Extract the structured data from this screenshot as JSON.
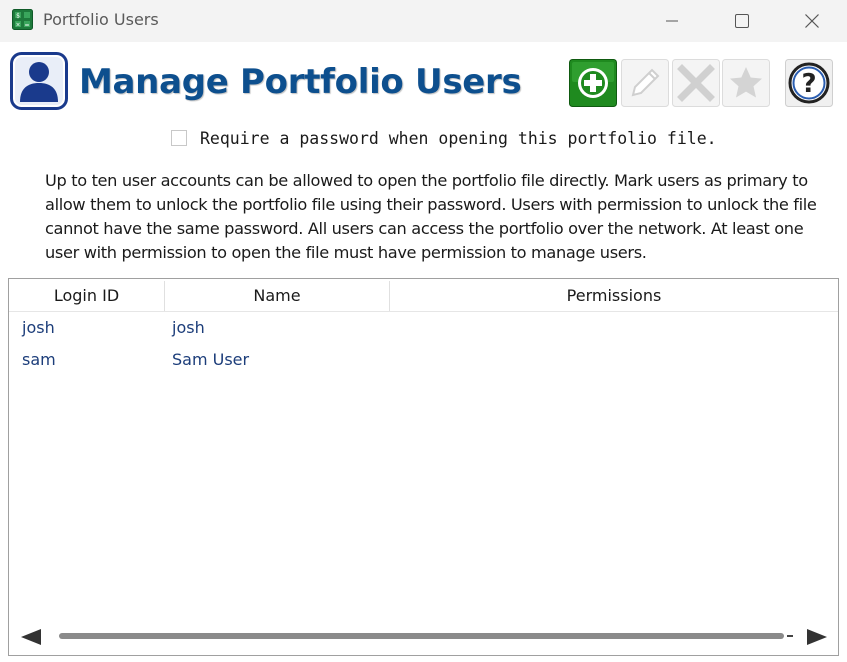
{
  "window": {
    "title": "Portfolio Users",
    "icon": "spreadsheet-icon"
  },
  "header": {
    "title": "Manage Portfolio Users",
    "icon": "user-icon"
  },
  "toolbar": {
    "buttons": [
      {
        "name": "add-user-button",
        "icon": "plus-icon",
        "enabled": true
      },
      {
        "name": "edit-user-button",
        "icon": "pencil-icon",
        "enabled": false
      },
      {
        "name": "delete-user-button",
        "icon": "x-icon",
        "enabled": false
      },
      {
        "name": "primary-user-button",
        "icon": "star-icon",
        "enabled": false
      },
      {
        "name": "help-button",
        "icon": "question-icon",
        "enabled": true
      }
    ]
  },
  "password_option": {
    "label": "Require a password when opening this portfolio file.",
    "checked": false
  },
  "description": "Up to ten user accounts can be allowed to open the portfolio file directly. Mark users as primary to allow them to unlock the portfolio file using their password. Users with permission to unlock the file cannot have the same password. All users can access the portfolio over the network. At least one user with permission to open the file must have permission to manage users.",
  "grid": {
    "columns": [
      "Login ID",
      "Name",
      "Permissions"
    ],
    "rows": [
      {
        "login_id": "josh",
        "name": "josh",
        "permissions": ""
      },
      {
        "login_id": "sam",
        "name": "Sam User",
        "permissions": ""
      }
    ]
  },
  "colors": {
    "title_blue": "#0d4f8e",
    "link_text": "#1c3d7a",
    "add_green": "#1f8a1f"
  }
}
